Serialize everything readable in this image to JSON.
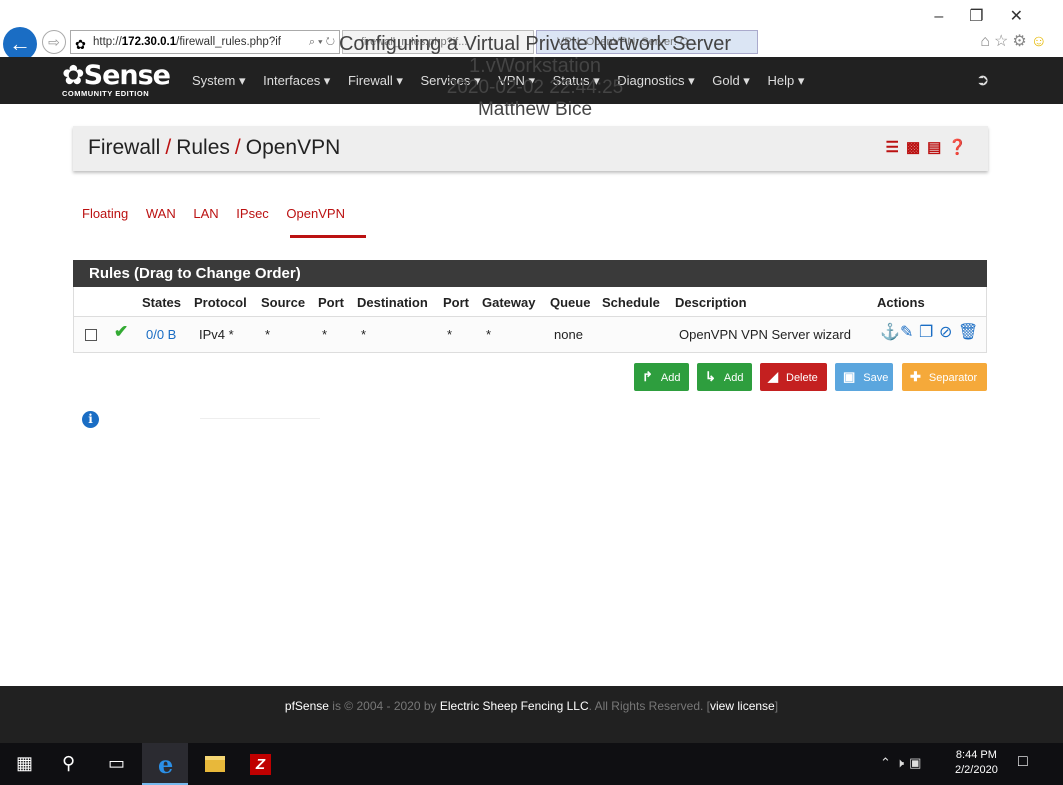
{
  "browser": {
    "url_prefix": "http://",
    "url_host": "172.30.0.1",
    "url_path": "/firewall_rules.php?if",
    "tab1_label": "firewall_rules.php?if...",
    "tab2_label": "VPN: OpenVPN: Server: O...",
    "addr_tools": "⌕ ▾ ↻"
  },
  "watermark": {
    "line1": "Configuring a Virtual Private Network Server",
    "line2": "1.vWorkstation",
    "line3": "2020-02-02 22:44:25",
    "line4": "Matthew Bice"
  },
  "navbar": {
    "logo_text": "Sense",
    "logo_sub": "COMMUNITY EDITION",
    "menu": [
      "System ▾",
      "Interfaces ▾",
      "Firewall ▾",
      "Services ▾",
      "VPN ▾",
      "Status ▾",
      "Diagnostics ▾",
      "Gold ▾",
      "Help ▾"
    ]
  },
  "page": {
    "crumb": [
      "Firewall",
      "Rules",
      "OpenVPN"
    ],
    "crumb_sep": "/"
  },
  "tabs": [
    "Floating",
    "WAN",
    "LAN",
    "IPsec",
    "OpenVPN"
  ],
  "rules_panel": {
    "title": "Rules (Drag to Change Order)",
    "columns": [
      "States",
      "Protocol",
      "Source",
      "Port",
      "Destination",
      "Port",
      "Gateway",
      "Queue",
      "Schedule",
      "Description",
      "Actions"
    ],
    "row": {
      "states": "0/0 B",
      "protocol": "IPv4 *",
      "source": "*",
      "source_port": "*",
      "destination": "*",
      "dest_port": "*",
      "gateway": "*",
      "queue": "none",
      "schedule": "",
      "description": "OpenVPN VPN Server wizard"
    }
  },
  "buttons": {
    "add_top": "Add",
    "add_bottom": "Add",
    "delete": "Delete",
    "save": "Save",
    "separator": "Separator"
  },
  "footer": {
    "brand": "pfSense",
    "text1": " is © 2004 - 2020 by ",
    "company": "Electric Sheep Fencing LLC",
    "text2": ". All Rights Reserved. [",
    "license": "view license",
    "text3": "]"
  },
  "taskbar": {
    "time": "8:44 PM",
    "date": "2/2/2020"
  },
  "colors": {
    "accent_red": "#bb1111",
    "link_blue": "#1a6dc4",
    "add_green": "#2e9e3e",
    "delete_red": "#c42020",
    "save_blue": "#5ba6de",
    "separator_orange": "#f5a93a"
  }
}
